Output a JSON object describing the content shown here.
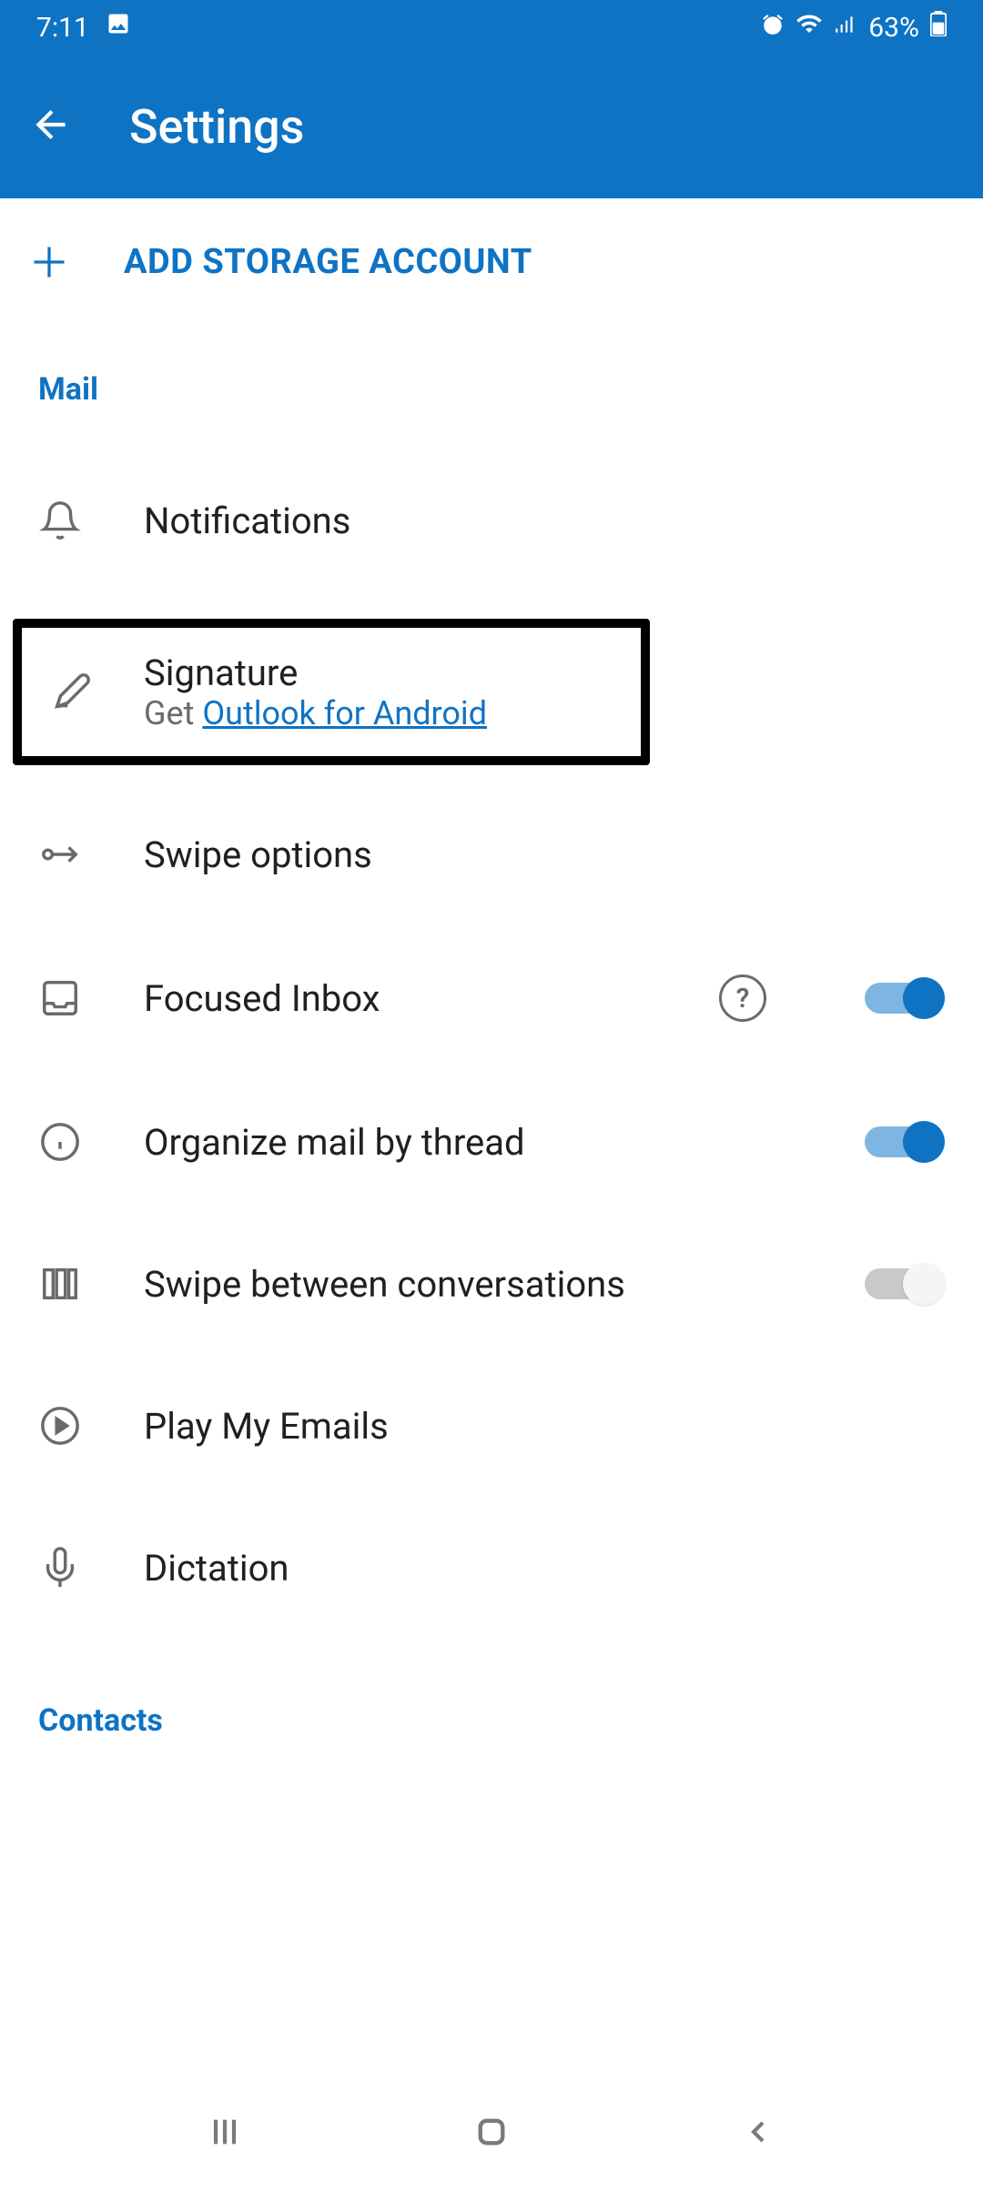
{
  "statusBar": {
    "time": "7:11",
    "battery": "63%"
  },
  "header": {
    "title": "Settings"
  },
  "addRow": {
    "label": "ADD STORAGE ACCOUNT"
  },
  "sections": {
    "mail": "Mail",
    "contacts": "Contacts"
  },
  "rows": {
    "notifications": "Notifications",
    "signature": {
      "title": "Signature",
      "subtitlePrefix": "Get ",
      "subtitleLink": "Outlook for Android"
    },
    "swipeOptions": "Swipe options",
    "focusedInbox": "Focused Inbox",
    "organizeThread": "Organize mail by thread",
    "swipeConv": "Swipe between conversations",
    "playEmails": "Play My Emails",
    "dictation": "Dictation"
  },
  "toggles": {
    "focusedInbox": true,
    "organizeThread": true,
    "swipeConv": false
  }
}
